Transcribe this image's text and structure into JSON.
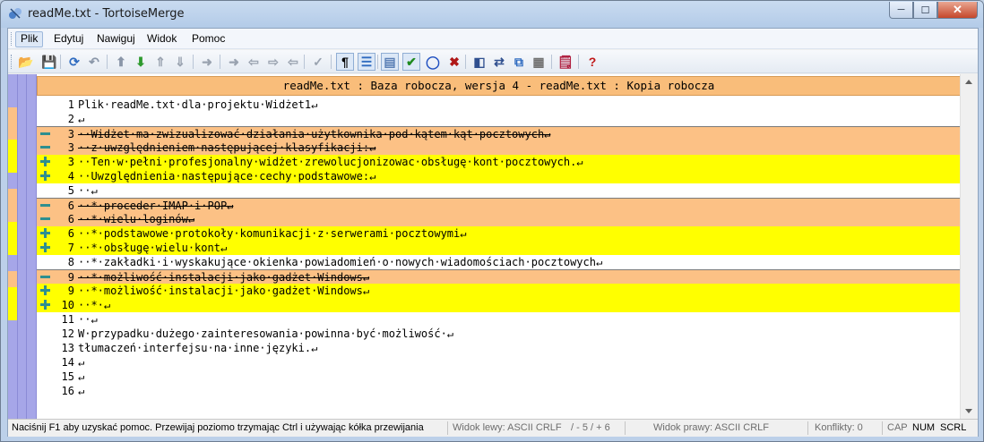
{
  "window": {
    "title": "readMe.txt - TortoiseMerge",
    "buttons": {
      "minimize": "─",
      "maximize": "☐",
      "close": "✕"
    }
  },
  "menu": [
    {
      "label": "Plik",
      "active": true
    },
    {
      "label": "Edytuj",
      "active": false
    },
    {
      "label": "Nawiguj",
      "active": false
    },
    {
      "label": "Widok",
      "active": false
    },
    {
      "label": "Pomoc",
      "active": false
    }
  ],
  "toolbar": [
    {
      "icon": "open-icon",
      "glyph": "📂",
      "color": "#c58a1c"
    },
    {
      "icon": "save-icon",
      "glyph": "💾",
      "color": "#7a8aa0"
    },
    {
      "icon": "reload-icon",
      "glyph": "⟳",
      "color": "#2f6bc0"
    },
    {
      "icon": "undo-icon",
      "glyph": "↶",
      "color": "#8a96a8"
    },
    {
      "icon": "prev-difference-icon",
      "glyph": "⬆",
      "color": "#8a96a8"
    },
    {
      "icon": "next-difference-icon",
      "glyph": "⬇",
      "color": "#2e9a2e"
    },
    {
      "icon": "prev-conflict-icon",
      "glyph": "⇑",
      "color": "#9aa3b0"
    },
    {
      "icon": "next-conflict-icon",
      "glyph": "⇓",
      "color": "#9aa3b0"
    },
    {
      "icon": "use-block-icon",
      "glyph": "➜",
      "color": "#9aa3b0"
    },
    {
      "icon": "use-left-block-icon",
      "glyph": "➜",
      "color": "#9aa3b0"
    },
    {
      "icon": "use-left-file-icon",
      "glyph": "⇦",
      "color": "#9aa3b0"
    },
    {
      "icon": "use-right-block-icon",
      "glyph": "⇨",
      "color": "#9aa3b0"
    },
    {
      "icon": "use-right-file-icon",
      "glyph": "⇦",
      "color": "#9aa3b0"
    },
    {
      "icon": "spellcheck-icon",
      "glyph": "✓",
      "color": "#9aa3b0"
    },
    {
      "icon": "show-whitespace-icon",
      "glyph": "¶",
      "color": "#000000",
      "pressed": true
    },
    {
      "icon": "inline-diff-icon",
      "glyph": "☰",
      "color": "#2f6bc0",
      "pressed": true
    },
    {
      "icon": "one-pane-view-icon",
      "glyph": "▤",
      "color": "#5a7fb5",
      "pressed": true
    },
    {
      "icon": "mark-resolved-icon",
      "glyph": "✔",
      "color": "#1f8a1f",
      "pressed": true
    },
    {
      "icon": "conflict-icon",
      "glyph": "◯",
      "color": "#1f4fc0"
    },
    {
      "icon": "discard-icon",
      "glyph": "✖",
      "color": "#b01818"
    },
    {
      "icon": "two-pane-view-icon",
      "glyph": "◧",
      "color": "#2f4f8f"
    },
    {
      "icon": "swap-views-icon",
      "glyph": "⇄",
      "color": "#2f4f8f"
    },
    {
      "icon": "create-patch-icon",
      "glyph": "⧉",
      "color": "#2f6bc0"
    },
    {
      "icon": "options-icon",
      "glyph": "▦",
      "color": "#707070"
    },
    {
      "icon": "settings-icon",
      "glyph": "🗒",
      "color": "#b02040"
    },
    {
      "icon": "help-icon",
      "glyph": "?",
      "color": "#c01818"
    }
  ],
  "editor": {
    "header": "readMe.txt : Baza robocza, wersja 4 - readMe.txt : Kopia robocza",
    "colors": {
      "removed": "#fcc185",
      "added": "#ffff00",
      "header": "#f9bd7a",
      "strip": "#a6a6e8"
    },
    "lines": [
      {
        "num": "1",
        "text": "Plik·readMe.txt·dla·projektu·Widżet1↵",
        "state": "normal"
      },
      {
        "num": "2",
        "text": "↵",
        "state": "normal"
      },
      {
        "num": "3",
        "text": "··Widżet·ma·zwizualizować·działania·użytkownika·pod·kątem·kąt·pocztowych↵",
        "state": "removed"
      },
      {
        "num": "3",
        "text": "··z·uwzględnieniem·następującej·klasyfikacji:↵",
        "state": "removed"
      },
      {
        "num": "3",
        "text": "··Ten·w·pełni·profesjonalny·widżet·zrewolucjonizowac·obsługę·kont·pocztowych.↵",
        "state": "added"
      },
      {
        "num": "4",
        "text": "··Uwzględnienia·następujące·cechy·podstawowe:↵",
        "state": "added"
      },
      {
        "num": "5",
        "text": "··↵",
        "state": "normal"
      },
      {
        "num": "6",
        "text": "··*·proceder·IMAP·i·POP↵",
        "state": "removed"
      },
      {
        "num": "6",
        "text": "··*·wielu·loginów↵",
        "state": "removed"
      },
      {
        "num": "6",
        "text": "··*·podstawowe·protokoły·komunikacji·z·serwerami·pocztowymi↵",
        "state": "added"
      },
      {
        "num": "7",
        "text": "··*·obsługę·wielu·kont↵",
        "state": "added"
      },
      {
        "num": "8",
        "text": "··*·zakładki·i·wyskakujące·okienka·powiadomień·o·nowych·wiadomościach·pocztowych↵",
        "state": "normal"
      },
      {
        "num": "9",
        "text": "··*·możliwość·instalacji·jako·gadżet·Windows↵",
        "state": "removed"
      },
      {
        "num": "9",
        "text": "··*·możliwość·instalacji·jako·gadżet·Windows↵",
        "state": "added"
      },
      {
        "num": "10",
        "text": "··*·↵",
        "state": "added"
      },
      {
        "num": "11",
        "text": "··↵",
        "state": "normal"
      },
      {
        "num": "12",
        "text": "W·przypadku·dużego·zainteresowania·powinna·być·możliwość·↵",
        "state": "normal"
      },
      {
        "num": "13",
        "text": "tłumaczeń·interfejsu·na·inne·języki.↵",
        "state": "normal"
      },
      {
        "num": "14",
        "text": "↵",
        "state": "normal"
      },
      {
        "num": "15",
        "text": "↵",
        "state": "normal"
      },
      {
        "num": "16",
        "text": "↵",
        "state": "normal"
      }
    ]
  },
  "status": {
    "help": "Naciśnij F1 aby uzyskać pomoc. Przewijaj poziomo trzymając Ctrl i używając kółka przewijania",
    "left_view": "Widok lewy: ASCII CRLF",
    "diff_count": "/ - 5 / + 6",
    "right_view": "Widok prawy: ASCII CRLF",
    "conflicts": "Konflikty: 0",
    "cap": "CAP",
    "num": "NUM",
    "scrl": "SCRL"
  }
}
